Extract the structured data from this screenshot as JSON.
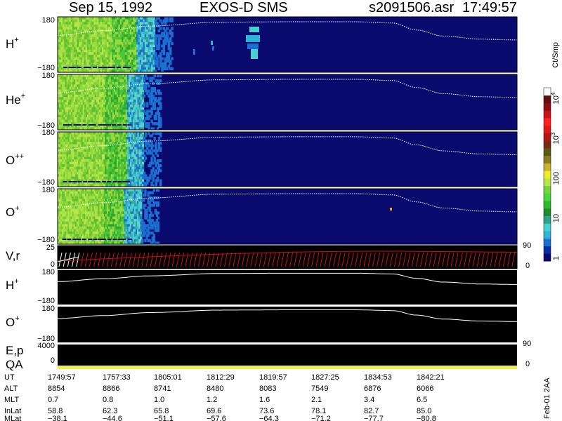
{
  "header": {
    "date": "Sep 15, 1992",
    "instrument": "EXOS-D SMS",
    "file": "s2091506.asr",
    "time": "17:49:57"
  },
  "colors": {
    "background": "#ffffff",
    "spectro_bg": "#0a0a6e",
    "line_panel_bg": "#000000",
    "trace": "#ffffff",
    "quality_bar": "#f2ee4a",
    "vr_hatch": "#cc1010"
  },
  "colorbar": {
    "unit_label": "Ct/Smp",
    "tick_labels": [
      "1",
      "10",
      "100",
      "10",
      "10",
      "10"
    ],
    "tick_exponents": [
      "",
      "",
      "",
      "3",
      "4",
      ""
    ],
    "tick_values": [
      1,
      10,
      100,
      1000,
      10000
    ],
    "colors_low_to_high": [
      "#0a0a6e",
      "#0b2fa0",
      "#1a6fd0",
      "#2fb3d8",
      "#46d0d0",
      "#2fa08a",
      "#1f8c2a",
      "#2db82d",
      "#45d83c",
      "#7ad23c",
      "#b6e64a",
      "#ecec28",
      "#c8b42a",
      "#8c7a1e",
      "#5a5a14",
      "#7a2814",
      "#b41414",
      "#e01a1a",
      "#ff2020",
      "#c81414",
      "#8c1010",
      "#601010",
      "#ffffff"
    ]
  },
  "panels": {
    "species": [
      {
        "name": "H",
        "charge": "+",
        "ytop": "180",
        "ybottom": "−180"
      },
      {
        "name": "He",
        "charge": "+",
        "ytop": "180",
        "ybottom": "−180"
      },
      {
        "name": "O",
        "charge": "++",
        "ytop": "180",
        "ybottom": "−180"
      },
      {
        "name": "O",
        "charge": "+",
        "ytop": "180",
        "ybottom": "−180"
      }
    ],
    "vr": {
      "label": "V,r",
      "y_top": "25",
      "y_bottom": "0",
      "right_top": "90",
      "right_bottom": "0"
    },
    "line_h": {
      "name": "H",
      "charge": "+",
      "ytop": "180",
      "ybottom": "−180"
    },
    "line_o": {
      "name": "O",
      "charge": "+",
      "ytop": "180",
      "ybottom": "−180"
    },
    "ep": {
      "label": "E,p",
      "y_top": "4000",
      "y_bottom": "0",
      "right_top": "90"
    },
    "qa": {
      "label": "QA",
      "y_bottom": "0",
      "right_bottom": "0"
    }
  },
  "side_label": "Feb-01 2AA",
  "chart_data": {
    "type": "heatmap",
    "x_unit": "UT",
    "x_range": [
      "1749:57",
      "1849:00"
    ],
    "y_range": [
      -180,
      180
    ],
    "trace_curve": [
      {
        "x": 0.0,
        "y": 60
      },
      {
        "x": 0.1,
        "y": 90
      },
      {
        "x": 0.2,
        "y": 120
      },
      {
        "x": 0.35,
        "y": 145
      },
      {
        "x": 0.5,
        "y": 148
      },
      {
        "x": 0.65,
        "y": 148
      },
      {
        "x": 0.73,
        "y": 140
      },
      {
        "x": 0.78,
        "y": 95
      },
      {
        "x": 0.84,
        "y": 55
      },
      {
        "x": 0.92,
        "y": 35
      },
      {
        "x": 1.0,
        "y": 30
      }
    ],
    "time_table": {
      "row_labels": [
        "UT",
        "ALT",
        "MLT",
        "InLat",
        "MLat"
      ],
      "columns": [
        {
          "UT": "1749:57",
          "ALT": "8854",
          "MLT": "0.7",
          "InLat": "58.8",
          "MLat": "−38.1"
        },
        {
          "UT": "1757:33",
          "ALT": "8866",
          "MLT": "0.8",
          "InLat": "62.3",
          "MLat": "−44.6"
        },
        {
          "UT": "1805:01",
          "ALT": "8741",
          "MLT": "1.0",
          "InLat": "65.8",
          "MLat": "−51.1"
        },
        {
          "UT": "1812:29",
          "ALT": "8480",
          "MLT": "1.2",
          "InLat": "69.6",
          "MLat": "−57.6"
        },
        {
          "UT": "1819:57",
          "ALT": "8083",
          "MLT": "1.6",
          "InLat": "73.6",
          "MLat": "−64.3"
        },
        {
          "UT": "1827:25",
          "ALT": "7549",
          "MLT": "2.1",
          "InLat": "78.1",
          "MLat": "−71.2"
        },
        {
          "UT": "1834:53",
          "ALT": "6876",
          "MLT": "3.4",
          "InLat": "82.7",
          "MLat": "−77.7"
        },
        {
          "UT": "1842:21",
          "ALT": "6066",
          "MLT": "6.5",
          "InLat": "85.0",
          "MLat": "−80.8"
        }
      ]
    }
  }
}
